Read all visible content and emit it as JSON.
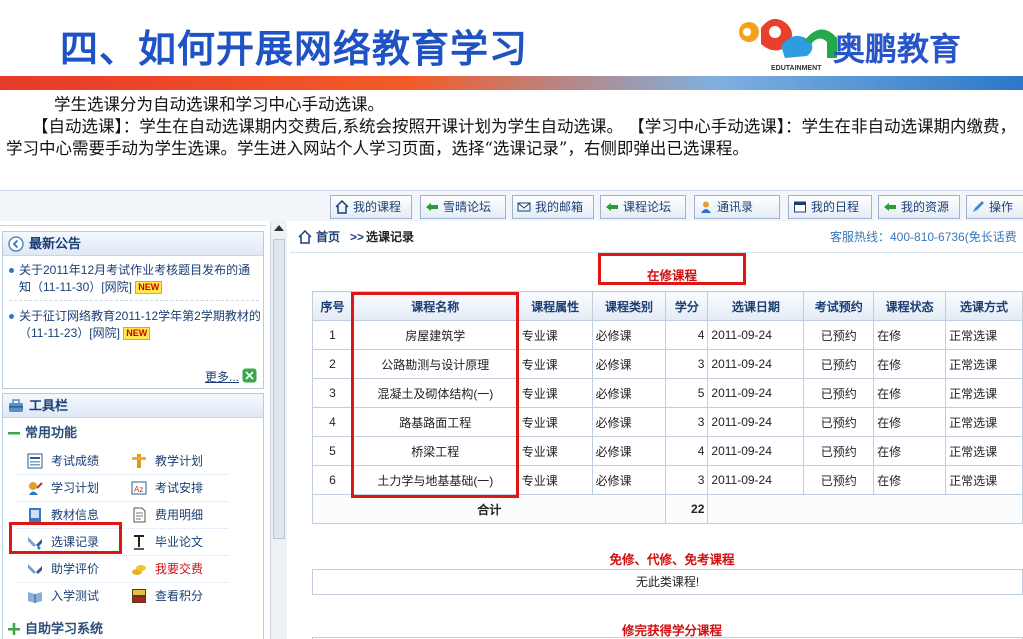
{
  "slide": {
    "title": "四、如何开展网络教育学习",
    "brand_name": "奥鹏教育",
    "brand_logo_caption": "EDUTAINMENT",
    "intro_1": "学生选课分为自动选课和学习中心手动选课。",
    "intro_2": "【自动选课】：学生在自动选课期内交费后,系统会按照开课计划为学生自动选课。 【学习中心手动选课】：学生在非自动选课期内缴费，学习中心需要手动为学生选课。学生进入网站个人学习页面，选择“选课记录”，右侧即弹出已选课程。"
  },
  "topnav": {
    "tabs": [
      {
        "label": "我的课程",
        "icon": "home-icon"
      },
      {
        "label": "雪晴论坛",
        "icon": "forum-icon"
      },
      {
        "label": "我的邮箱",
        "icon": "mail-icon"
      },
      {
        "label": "课程论坛",
        "icon": "forum-icon"
      },
      {
        "label": "通讯录",
        "icon": "contacts-icon"
      },
      {
        "label": "我的日程",
        "icon": "calendar-icon"
      },
      {
        "label": "我的资源",
        "icon": "resource-icon"
      },
      {
        "label": "操作",
        "icon": "pen-icon"
      }
    ]
  },
  "sidebar": {
    "announcements": {
      "title": "最新公告",
      "items": [
        {
          "text": "关于2011年12月考试作业考核题目发布的通知（11-11-30）[网院]",
          "badge": "NEW"
        },
        {
          "text": "关于征订网络教育2011-12学年第2学期教材的（11-11-23）[网院]",
          "badge": "NEW"
        }
      ],
      "more": "更多..."
    },
    "toolbar": {
      "title": "工具栏",
      "group_common": "常用功能",
      "tools": [
        {
          "label": "考试成绩",
          "icon": "grades-icon"
        },
        {
          "label": "教学计划",
          "icon": "plan-icon"
        },
        {
          "label": "学习计划",
          "icon": "study-plan-icon"
        },
        {
          "label": "考试安排",
          "icon": "exam-schedule-icon"
        },
        {
          "label": "教材信息",
          "icon": "textbook-icon"
        },
        {
          "label": "费用明细",
          "icon": "fees-icon"
        },
        {
          "label": "选课记录",
          "icon": "course-record-icon"
        },
        {
          "label": "毕业论文",
          "icon": "thesis-icon"
        },
        {
          "label": "助学评价",
          "icon": "evaluation-icon"
        },
        {
          "label": "我要交费",
          "icon": "payment-icon"
        },
        {
          "label": "入学测试",
          "icon": "entrance-test-icon"
        },
        {
          "label": "查看积分",
          "icon": "points-icon"
        }
      ],
      "group_self": "自助学习系统"
    }
  },
  "main": {
    "breadcrumb_home": "首页",
    "breadcrumb_sep": ">>",
    "breadcrumb_current": "选课记录",
    "hotline": "客服热线：400-810-6736(免长话费",
    "section_current": "在修课程",
    "columns": [
      "序号",
      "课程名称",
      "课程属性",
      "课程类别",
      "学分",
      "选课日期",
      "考试预约",
      "课程状态",
      "选课方式"
    ],
    "rows": [
      [
        "1",
        "房屋建筑学",
        "专业课",
        "必修课",
        "4",
        "2011-09-24",
        "已预约",
        "在修",
        "正常选课"
      ],
      [
        "2",
        "公路勘测与设计原理",
        "专业课",
        "必修课",
        "3",
        "2011-09-24",
        "已预约",
        "在修",
        "正常选课"
      ],
      [
        "3",
        "混凝土及砌体结构(一)",
        "专业课",
        "必修课",
        "5",
        "2011-09-24",
        "已预约",
        "在修",
        "正常选课"
      ],
      [
        "4",
        "路基路面工程",
        "专业课",
        "必修课",
        "3",
        "2011-09-24",
        "已预约",
        "在修",
        "正常选课"
      ],
      [
        "5",
        "桥梁工程",
        "专业课",
        "必修课",
        "4",
        "2011-09-24",
        "已预约",
        "在修",
        "正常选课"
      ],
      [
        "6",
        "土力学与地基基础(一)",
        "专业课",
        "必修课",
        "3",
        "2011-09-24",
        "已预约",
        "在修",
        "正常选课"
      ]
    ],
    "total_label": "合计",
    "total_credits": "22",
    "section_exempt": "免修、代修、免考课程",
    "exempt_empty": "无此类课程!",
    "section_completed": "修完获得学分课程"
  },
  "colors": {
    "title_blue": "#1f52c4",
    "highlight_red": "#e01515",
    "link_blue": "#1b3f74"
  }
}
